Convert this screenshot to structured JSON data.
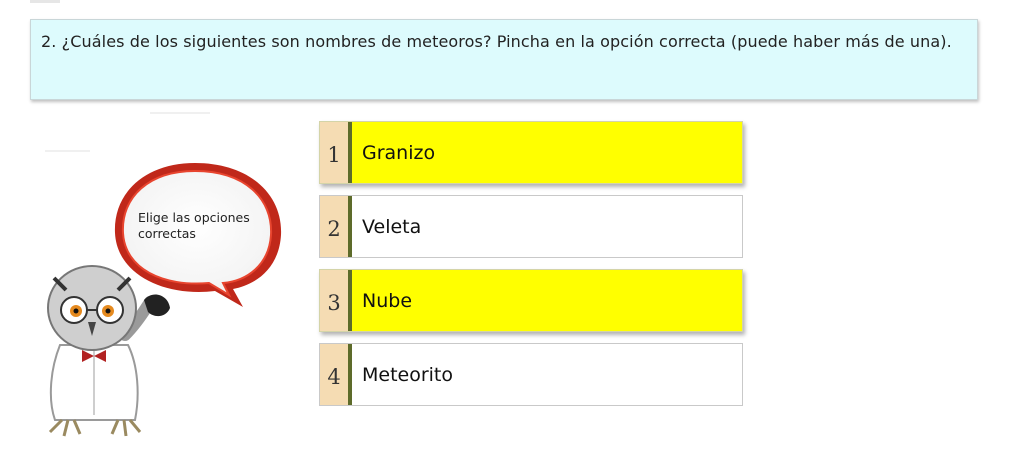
{
  "question": {
    "text": "2. ¿Cuáles de los siguientes son nombres de meteoros? Pincha en la opción correcta (puede haber más de una)."
  },
  "bubble": {
    "text": "Elige las opciones correctas"
  },
  "options": [
    {
      "number": "1",
      "label": "Granizo",
      "selected": true
    },
    {
      "number": "2",
      "label": "Veleta",
      "selected": false
    },
    {
      "number": "3",
      "label": "Nube",
      "selected": true
    },
    {
      "number": "4",
      "label": "Meteorito",
      "selected": false
    }
  ],
  "colors": {
    "question_bg": "#ddfbfd",
    "selected_bg": "#ffff00",
    "number_bg": "#f5dcb3",
    "number_bar": "#5d6b2a",
    "bubble_red": "#d7301f"
  },
  "icons": {
    "mascot": "owl-teacher-icon",
    "bubble": "speech-bubble-icon"
  }
}
